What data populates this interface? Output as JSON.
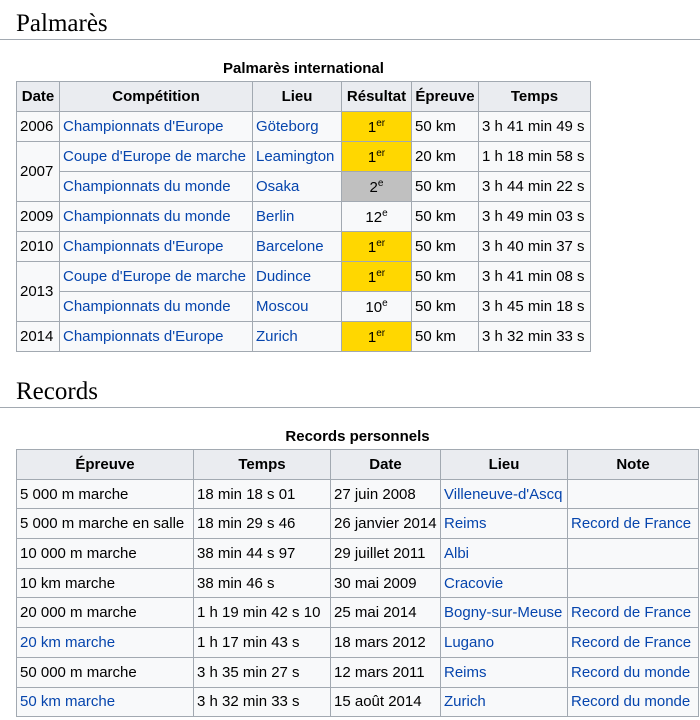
{
  "palmares_heading": "Palmarès",
  "records_heading": "Records",
  "palmares": {
    "caption": "Palmarès international",
    "headers": [
      "Date",
      "Compétition",
      "Lieu",
      "Résultat",
      "Épreuve",
      "Temps"
    ],
    "rows": [
      {
        "date": "2006",
        "competition": "Championnats d'Europe",
        "lieu": "Göteborg",
        "place": "1",
        "sup": "er",
        "medal": "gold",
        "epreuve": "50 km",
        "temps": "3 h 41 min 49 s"
      },
      {
        "date": "2007",
        "competition": "Coupe d'Europe de marche",
        "lieu": "Leamington",
        "place": "1",
        "sup": "er",
        "medal": "gold",
        "epreuve": "20 km",
        "temps": "1 h 18 min 58 s"
      },
      {
        "date": "",
        "competition": "Championnats du monde",
        "lieu": "Osaka",
        "place": "2",
        "sup": "e",
        "medal": "silver",
        "epreuve": "50 km",
        "temps": "3 h 44 min 22 s"
      },
      {
        "date": "2009",
        "competition": "Championnats du monde",
        "lieu": "Berlin",
        "place": "12",
        "sup": "e",
        "medal": "",
        "epreuve": "50 km",
        "temps": "3 h 49 min 03 s"
      },
      {
        "date": "2010",
        "competition": "Championnats d'Europe",
        "lieu": "Barcelone",
        "place": "1",
        "sup": "er",
        "medal": "gold",
        "epreuve": "50 km",
        "temps": "3 h 40 min 37 s"
      },
      {
        "date": "2013",
        "competition": "Coupe d'Europe de marche",
        "lieu": "Dudince",
        "place": "1",
        "sup": "er",
        "medal": "gold",
        "epreuve": "50 km",
        "temps": "3 h 41 min 08 s"
      },
      {
        "date": "",
        "competition": "Championnats du monde",
        "lieu": "Moscou",
        "place": "10",
        "sup": "e",
        "medal": "",
        "epreuve": "50 km",
        "temps": "3 h 45 min 18 s"
      },
      {
        "date": "2014",
        "competition": "Championnats d'Europe",
        "lieu": "Zurich",
        "place": "1",
        "sup": "er",
        "medal": "gold",
        "epreuve": "50 km",
        "temps": "3 h 32 min 33 s"
      }
    ]
  },
  "records": {
    "caption": "Records personnels",
    "headers": [
      "Épreuve",
      "Temps",
      "Date",
      "Lieu",
      "Note"
    ],
    "rows": [
      {
        "epreuve": "5 000 m marche",
        "temps": "18 min 18 s 01",
        "date": "27 juin 2008",
        "lieu": "Villeneuve-d'Ascq",
        "note": ""
      },
      {
        "epreuve": "5 000 m marche en salle",
        "temps": "18 min 29 s 46",
        "date": "26 janvier 2014",
        "lieu": "Reims",
        "note": "Record de France"
      },
      {
        "epreuve": "10 000 m marche",
        "temps": "38 min 44 s 97",
        "date": "29 juillet 2011",
        "lieu": "Albi",
        "note": ""
      },
      {
        "epreuve": "10 km marche",
        "temps": "38 min 46 s",
        "date": "30 mai 2009",
        "lieu": "Cracovie",
        "note": ""
      },
      {
        "epreuve": "20 000 m marche",
        "temps": "1 h 19 min 42 s 10",
        "date": "25 mai 2014",
        "lieu": "Bogny-sur-Meuse",
        "note": "Record de France"
      },
      {
        "epreuve": "20 km marche",
        "temps": "1 h 17 min 43 s",
        "date": "18 mars 2012",
        "lieu": "Lugano",
        "note": "Record de France"
      },
      {
        "epreuve": "50 000 m marche",
        "temps": "3 h 35 min 27 s",
        "date": "12 mars 2011",
        "lieu": "Reims",
        "note": "Record du monde"
      },
      {
        "epreuve": "50 km marche",
        "temps": "3 h 32 min 33 s",
        "date": "15 août 2014",
        "lieu": "Zurich",
        "note": "Record du monde"
      }
    ]
  },
  "colors": {
    "link": "#0645ad",
    "gold": "#ffd700",
    "silver": "#c0c0c0",
    "header_bg": "#eaecf0",
    "border": "#a2a9b1"
  }
}
